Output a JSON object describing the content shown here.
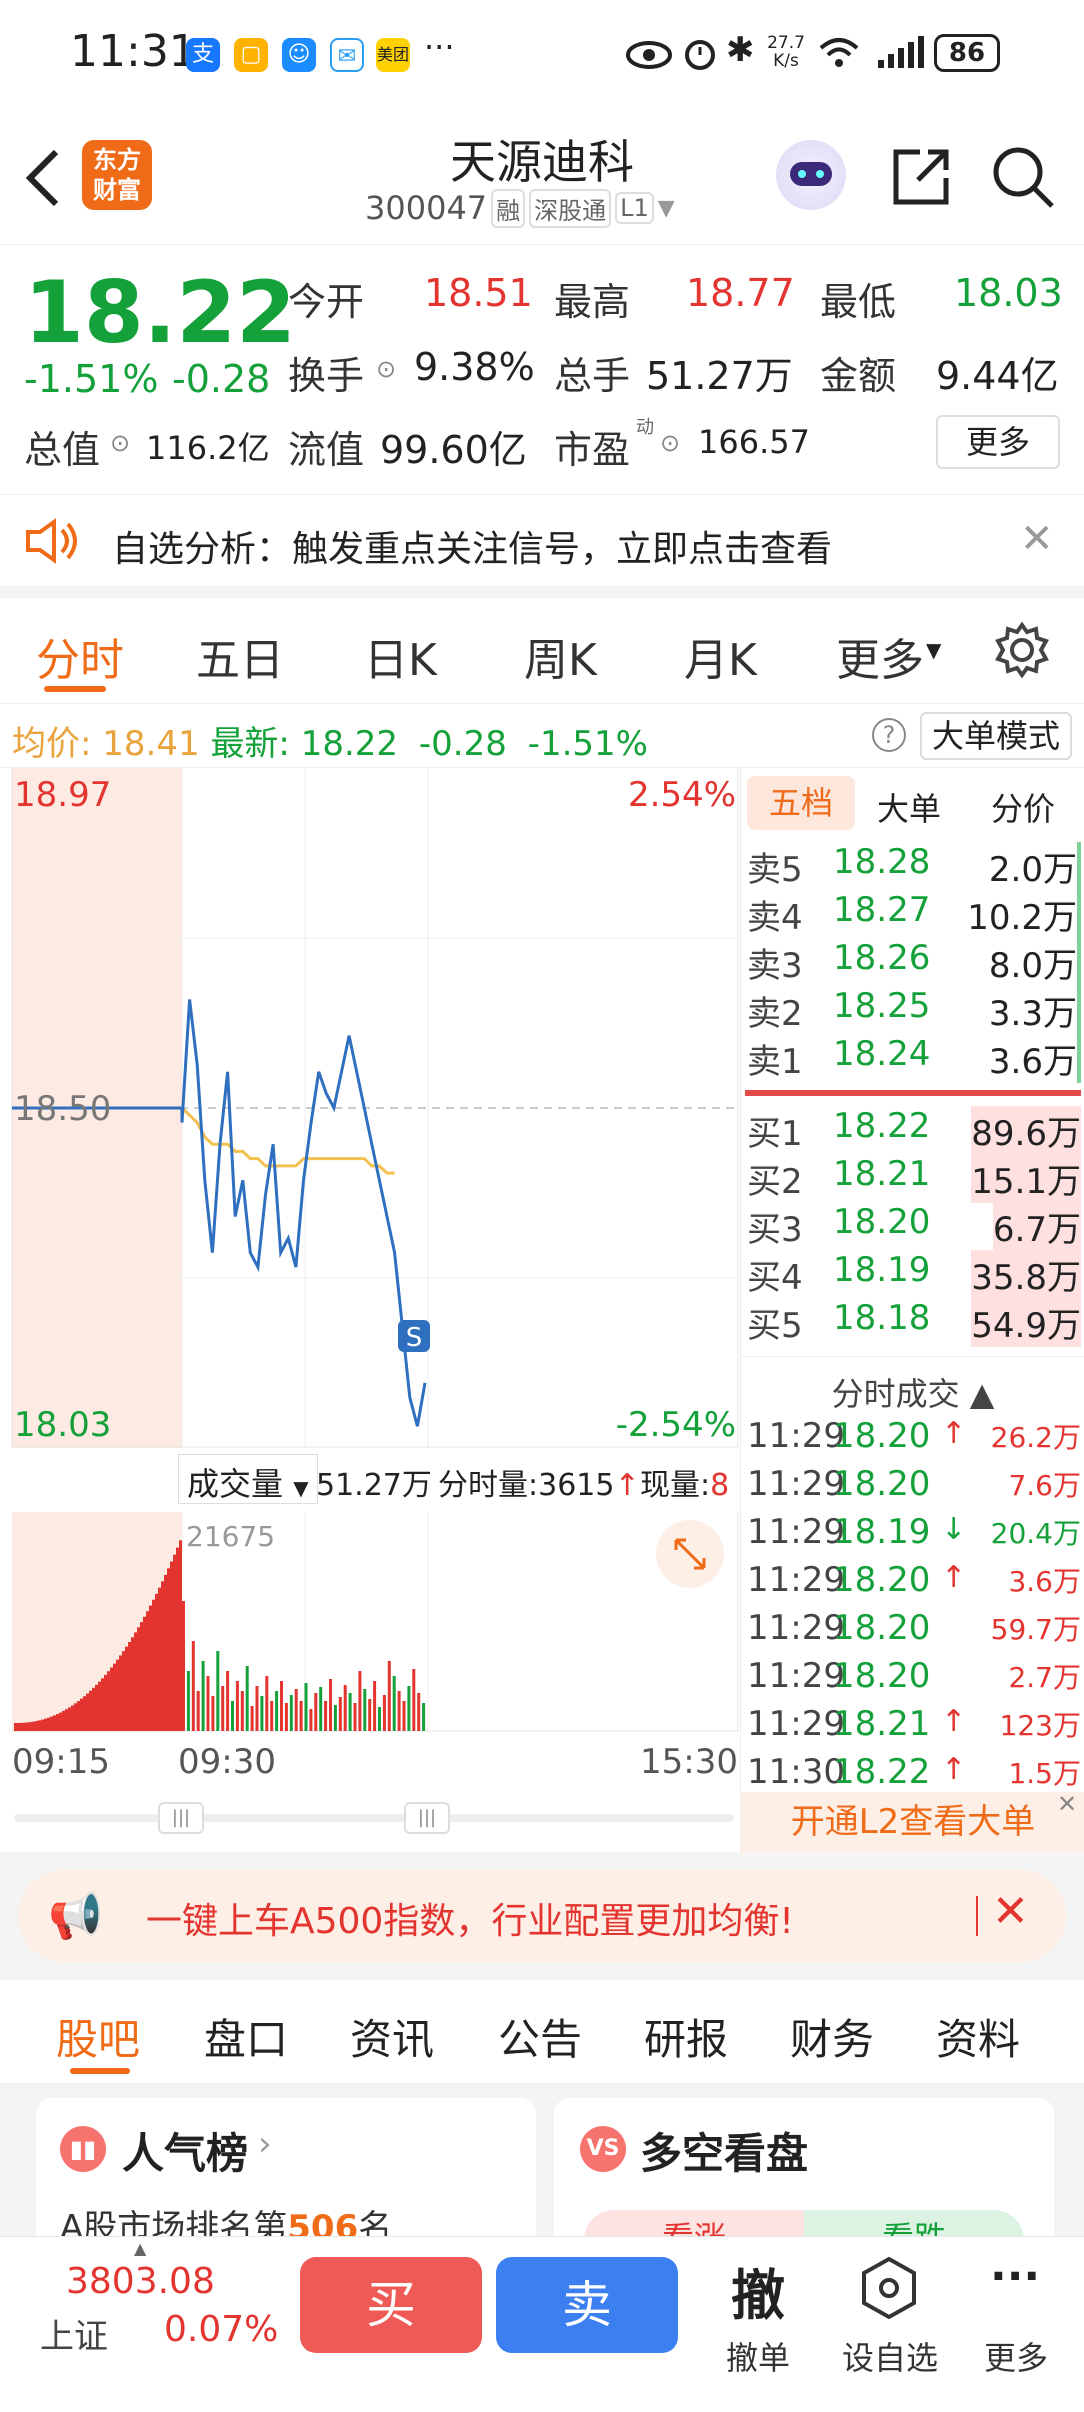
{
  "status": {
    "time": "11:31",
    "net_speed_top": "27.7",
    "net_speed_bottom": "K/s",
    "battery": "86",
    "more": "···"
  },
  "header": {
    "back_icon": "chevron-left-icon",
    "logo_line1": "东方",
    "logo_line2": "财富",
    "name": "天源迪科",
    "code": "300047",
    "tags": [
      "融",
      "深股通",
      "L1"
    ]
  },
  "quote": {
    "price": "18.22",
    "change_pct": "-1.51%",
    "change_abs": "-0.28",
    "open_label": "今开",
    "open": "18.51",
    "high_label": "最高",
    "high": "18.77",
    "low_label": "最低",
    "low": "18.03",
    "turnover_label": "换手",
    "turnover": "9.38%",
    "volume_label": "总手",
    "volume": "51.27万",
    "amount_label": "金额",
    "amount": "9.44亿",
    "mcap_label": "总值",
    "mcap": "116.2亿",
    "float_label": "流值",
    "float": "99.60亿",
    "pe_label": "市盈",
    "pe_sup": "动",
    "pe": "166.57",
    "more_btn": "更多"
  },
  "notice": {
    "text": "自选分析：触发重点关注信号，立即点击查看"
  },
  "chart_tabs": [
    "分时",
    "五日",
    "日K",
    "周K",
    "月K",
    "更多"
  ],
  "avg_line": {
    "avg_label": "均价:",
    "avg": "18.41",
    "last_label": "最新:",
    "last": "18.22",
    "chg": "-0.28",
    "pct": "-1.51%",
    "big_mode": "大单模式"
  },
  "chart_data": {
    "type": "line",
    "ylim": [
      18.03,
      18.97
    ],
    "y_top": "18.97",
    "y_bottom": "18.03",
    "y_mid": "18.50",
    "pct_top": "2.54%",
    "pct_bottom": "-2.54%",
    "x_labels": [
      "09:15",
      "09:30",
      "15:30"
    ],
    "price": [
      18.5,
      18.5,
      18.5,
      18.5,
      18.5,
      18.5,
      18.5,
      18.5,
      18.5,
      18.5,
      18.5,
      18.5,
      18.5,
      18.48,
      18.65,
      18.56,
      18.4,
      18.3,
      18.45,
      18.55,
      18.35,
      18.4,
      18.3,
      18.28,
      18.38,
      18.45,
      18.3,
      18.32,
      18.28,
      18.4,
      18.48,
      18.55,
      18.52,
      18.5,
      18.55,
      18.6,
      18.55,
      18.5,
      18.45,
      18.4,
      18.35,
      18.3,
      18.2,
      18.1,
      18.06,
      18.12
    ],
    "avg": [
      null,
      null,
      null,
      null,
      null,
      null,
      null,
      null,
      null,
      null,
      null,
      null,
      null,
      18.5,
      18.49,
      18.48,
      18.46,
      18.45,
      18.45,
      18.45,
      18.44,
      18.44,
      18.43,
      18.43,
      18.42,
      18.42,
      18.42,
      18.42,
      18.42,
      18.43,
      18.43,
      18.43,
      18.43,
      18.43,
      18.43,
      18.43,
      18.43,
      18.43,
      18.42,
      18.42,
      18.41,
      18.41
    ],
    "s_marker": "S",
    "vol_max": "21675"
  },
  "vol_bar": {
    "label": "成交量",
    "total": "51.27万",
    "period_label": "分时量:3615",
    "now_label": "现量:",
    "now": "8"
  },
  "orderbook": {
    "tabs": [
      "五档",
      "大单",
      "分价"
    ],
    "sells": [
      {
        "l": "卖5",
        "p": "18.28",
        "v": "2.0万"
      },
      {
        "l": "卖4",
        "p": "18.27",
        "v": "10.2万"
      },
      {
        "l": "卖3",
        "p": "18.26",
        "v": "8.0万"
      },
      {
        "l": "卖2",
        "p": "18.25",
        "v": "3.3万"
      },
      {
        "l": "卖1",
        "p": "18.24",
        "v": "3.6万"
      }
    ],
    "buys": [
      {
        "l": "买1",
        "p": "18.22",
        "v": "89.6万"
      },
      {
        "l": "买2",
        "p": "18.21",
        "v": "15.1万"
      },
      {
        "l": "买3",
        "p": "18.20",
        "v": "6.7万"
      },
      {
        "l": "买4",
        "p": "18.19",
        "v": "35.8万"
      },
      {
        "l": "买5",
        "p": "18.18",
        "v": "54.9万"
      }
    ],
    "ticks_title": "分时成交",
    "ticks": [
      {
        "t": "11:29",
        "p": "18.20",
        "a": "↑",
        "v": "26.2万"
      },
      {
        "t": "11:29",
        "p": "18.20",
        "a": "",
        "v": "7.6万"
      },
      {
        "t": "11:29",
        "p": "18.19",
        "a": "↓",
        "v": "20.4万"
      },
      {
        "t": "11:29",
        "p": "18.20",
        "a": "↑",
        "v": "3.6万"
      },
      {
        "t": "11:29",
        "p": "18.20",
        "a": "",
        "v": "59.7万"
      },
      {
        "t": "11:29",
        "p": "18.20",
        "a": "",
        "v": "2.7万"
      },
      {
        "t": "11:29",
        "p": "18.21",
        "a": "↑",
        "v": "123万"
      },
      {
        "t": "11:30",
        "p": "18.22",
        "a": "↑",
        "v": "1.5万"
      }
    ],
    "l2_btn": "开通L2查看大单"
  },
  "banner": {
    "text": "一键上车A500指数，行业配置更加均衡!"
  },
  "section_tabs": [
    "股吧",
    "盘口",
    "资讯",
    "公告",
    "研报",
    "财务",
    "资料"
  ],
  "cards": {
    "hot_title": "人气榜",
    "hot_rank_prefix": "A股市场排名第",
    "hot_rank": "506",
    "hot_rank_suffix": "名",
    "vs_title": "多空看盘",
    "vs_up": "看涨",
    "vs_down": "看跌"
  },
  "bottom": {
    "index_value": "3803.08",
    "index_name": "上证",
    "index_pct": "0.07%",
    "buy": "买",
    "sell": "卖",
    "cancel_glyph": "撤",
    "cancel": "撤单",
    "watch": "设自选",
    "more": "更多"
  }
}
